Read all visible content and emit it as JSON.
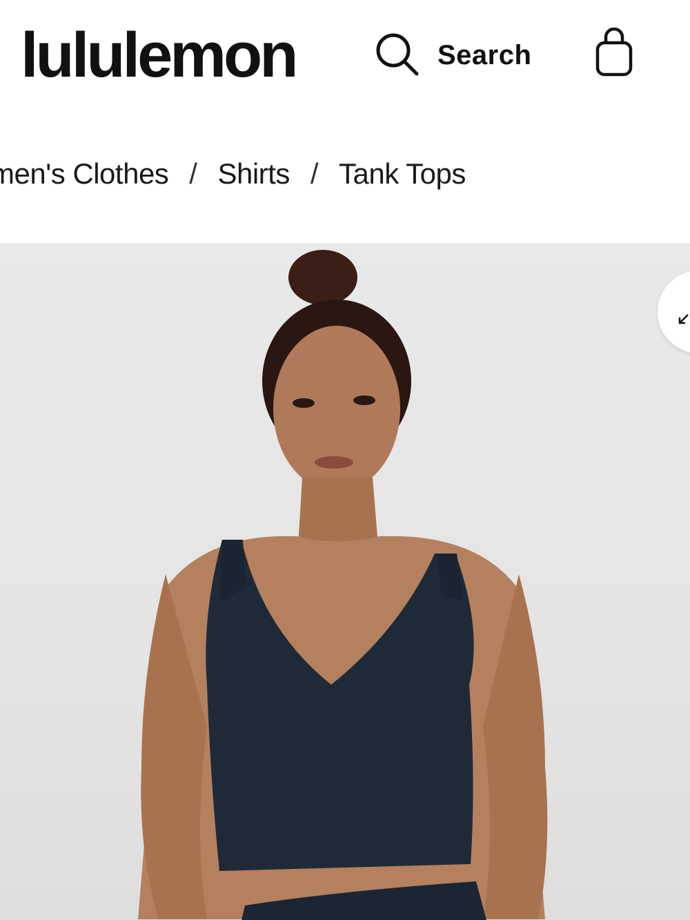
{
  "header": {
    "logo_text": "lululemon",
    "search_label": "Search"
  },
  "breadcrumb": {
    "items": [
      "men's Clothes",
      "Shirts",
      "Tank Tops"
    ],
    "separator": "/"
  },
  "product_image": {
    "alt": "Model wearing a navy V-neck crop tank top",
    "tank_color": "#1f2a38",
    "background_color": "#e6e6e6"
  },
  "icons": {
    "search": "search-icon",
    "bag": "shopping-bag-icon",
    "zoom": "expand-arrow-icon"
  }
}
